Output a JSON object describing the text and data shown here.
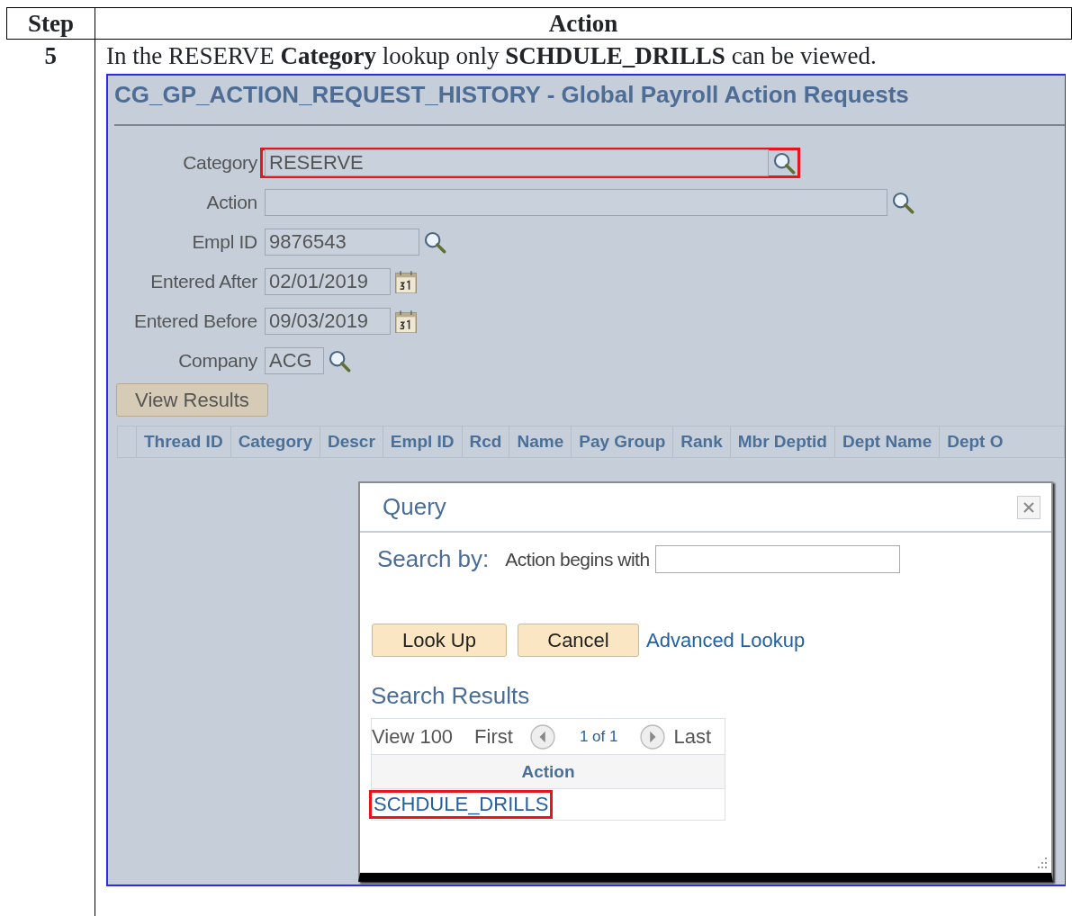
{
  "document": {
    "columns": [
      "Step",
      "Action"
    ],
    "step": "5",
    "instruction": "In the RESERVE **Category** lookup only **SCHDULE_DRILLS** can be viewed."
  },
  "screenshot": {
    "title": "CG_GP_ACTION_REQUEST_HISTORY - Global Payroll Action Requests",
    "fields": [
      {
        "label": "Category",
        "value": "RESERVE",
        "kind": "lookup",
        "highlighted": true
      },
      {
        "label": "Action",
        "kind": "lookup",
        "highlighted": false
      },
      {
        "label": "Empl ID",
        "value": "9876543",
        "kind": "lookup",
        "highlighted": false
      },
      {
        "label": "Entered After",
        "value": "02/01/2019",
        "kind": "date",
        "highlighted": false
      },
      {
        "label": "Entered Before",
        "value": "09/03/2019",
        "kind": "date",
        "highlighted": false
      },
      {
        "label": "Company",
        "value": "ACG",
        "kind": "lookup",
        "highlighted": false
      }
    ],
    "view_button": "View Results",
    "columns": [
      "Thread ID",
      "Category",
      "Descr",
      "Empl ID",
      "Rcd",
      "Name",
      "Pay Group",
      "Rank",
      "Mbr Deptid",
      "Dept Name",
      "Dept O"
    ],
    "dialog": {
      "title": "Query",
      "search_by": "Search by:",
      "search_label": "Action begins with",
      "buttons": [
        "Look Up",
        "Cancel"
      ],
      "advanced_link": "Advanced Lookup",
      "results_title": "Search Results",
      "pager": {
        "view": "View 100",
        "first": "First",
        "range": "1 of 1",
        "last": "Last"
      },
      "results_column": "Action",
      "rows": [
        {
          "value": "SCHDULE_DRILLS",
          "highlighted": true
        }
      ]
    }
  }
}
